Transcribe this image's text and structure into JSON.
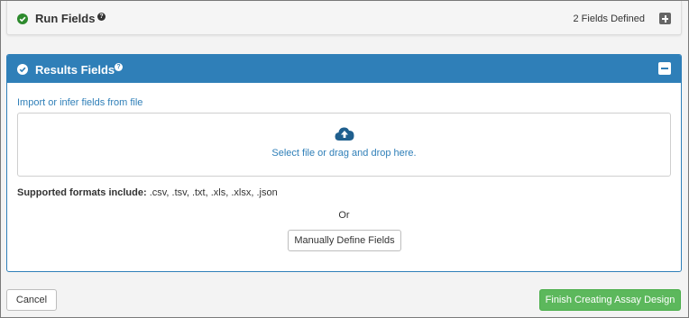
{
  "run_fields": {
    "title": "Run Fields",
    "help_glyph": "?",
    "status_icon": "check-circle-icon",
    "count_label": "2 Fields Defined",
    "expand_icon": "plus-square-icon"
  },
  "results_fields": {
    "title": "Results Fields",
    "help_glyph": "?",
    "status_icon": "check-circle-icon",
    "collapse_icon": "minus-square-icon",
    "import_link": "Import or infer fields from file",
    "upload_icon": "cloud-upload-icon",
    "drop_text": "Select file or drag and drop here.",
    "formats_label": "Supported formats include:",
    "formats_list": ".csv, .tsv, .txt, .xls, .xlsx, .json",
    "or_text": "Or",
    "manual_button": "Manually Define Fields"
  },
  "footer": {
    "cancel_label": "Cancel",
    "finish_label": "Finish Creating Assay Design"
  },
  "colors": {
    "accent": "#2f7fb8",
    "success": "#5cb85c",
    "check_green": "#2d8a2d"
  }
}
